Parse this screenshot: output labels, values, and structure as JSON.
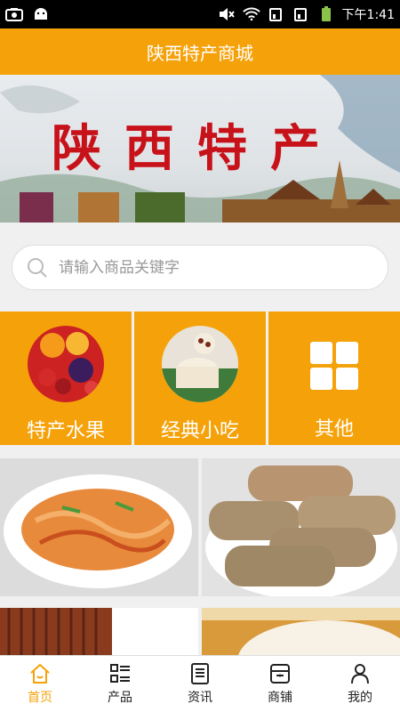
{
  "status_bar": {
    "time": "下午1:41"
  },
  "app_bar": {
    "title": "陕西特产商城"
  },
  "banner": {
    "title": "陕西特产"
  },
  "search": {
    "placeholder": "请输入商品关键字"
  },
  "categories": [
    {
      "label": "特产水果",
      "icon": "fruit-image"
    },
    {
      "label": "经典小吃",
      "icon": "snack-image"
    },
    {
      "label": "其他",
      "icon": "grid-icon"
    }
  ],
  "tabs": [
    {
      "label": "首页",
      "icon": "home-icon",
      "active": true
    },
    {
      "label": "产品",
      "icon": "list-icon",
      "active": false
    },
    {
      "label": "资讯",
      "icon": "document-icon",
      "active": false
    },
    {
      "label": "商铺",
      "icon": "store-icon",
      "active": false
    },
    {
      "label": "我的",
      "icon": "user-icon",
      "active": false
    }
  ],
  "colors": {
    "accent": "#f5a20a",
    "banner_text": "#c8121a"
  }
}
